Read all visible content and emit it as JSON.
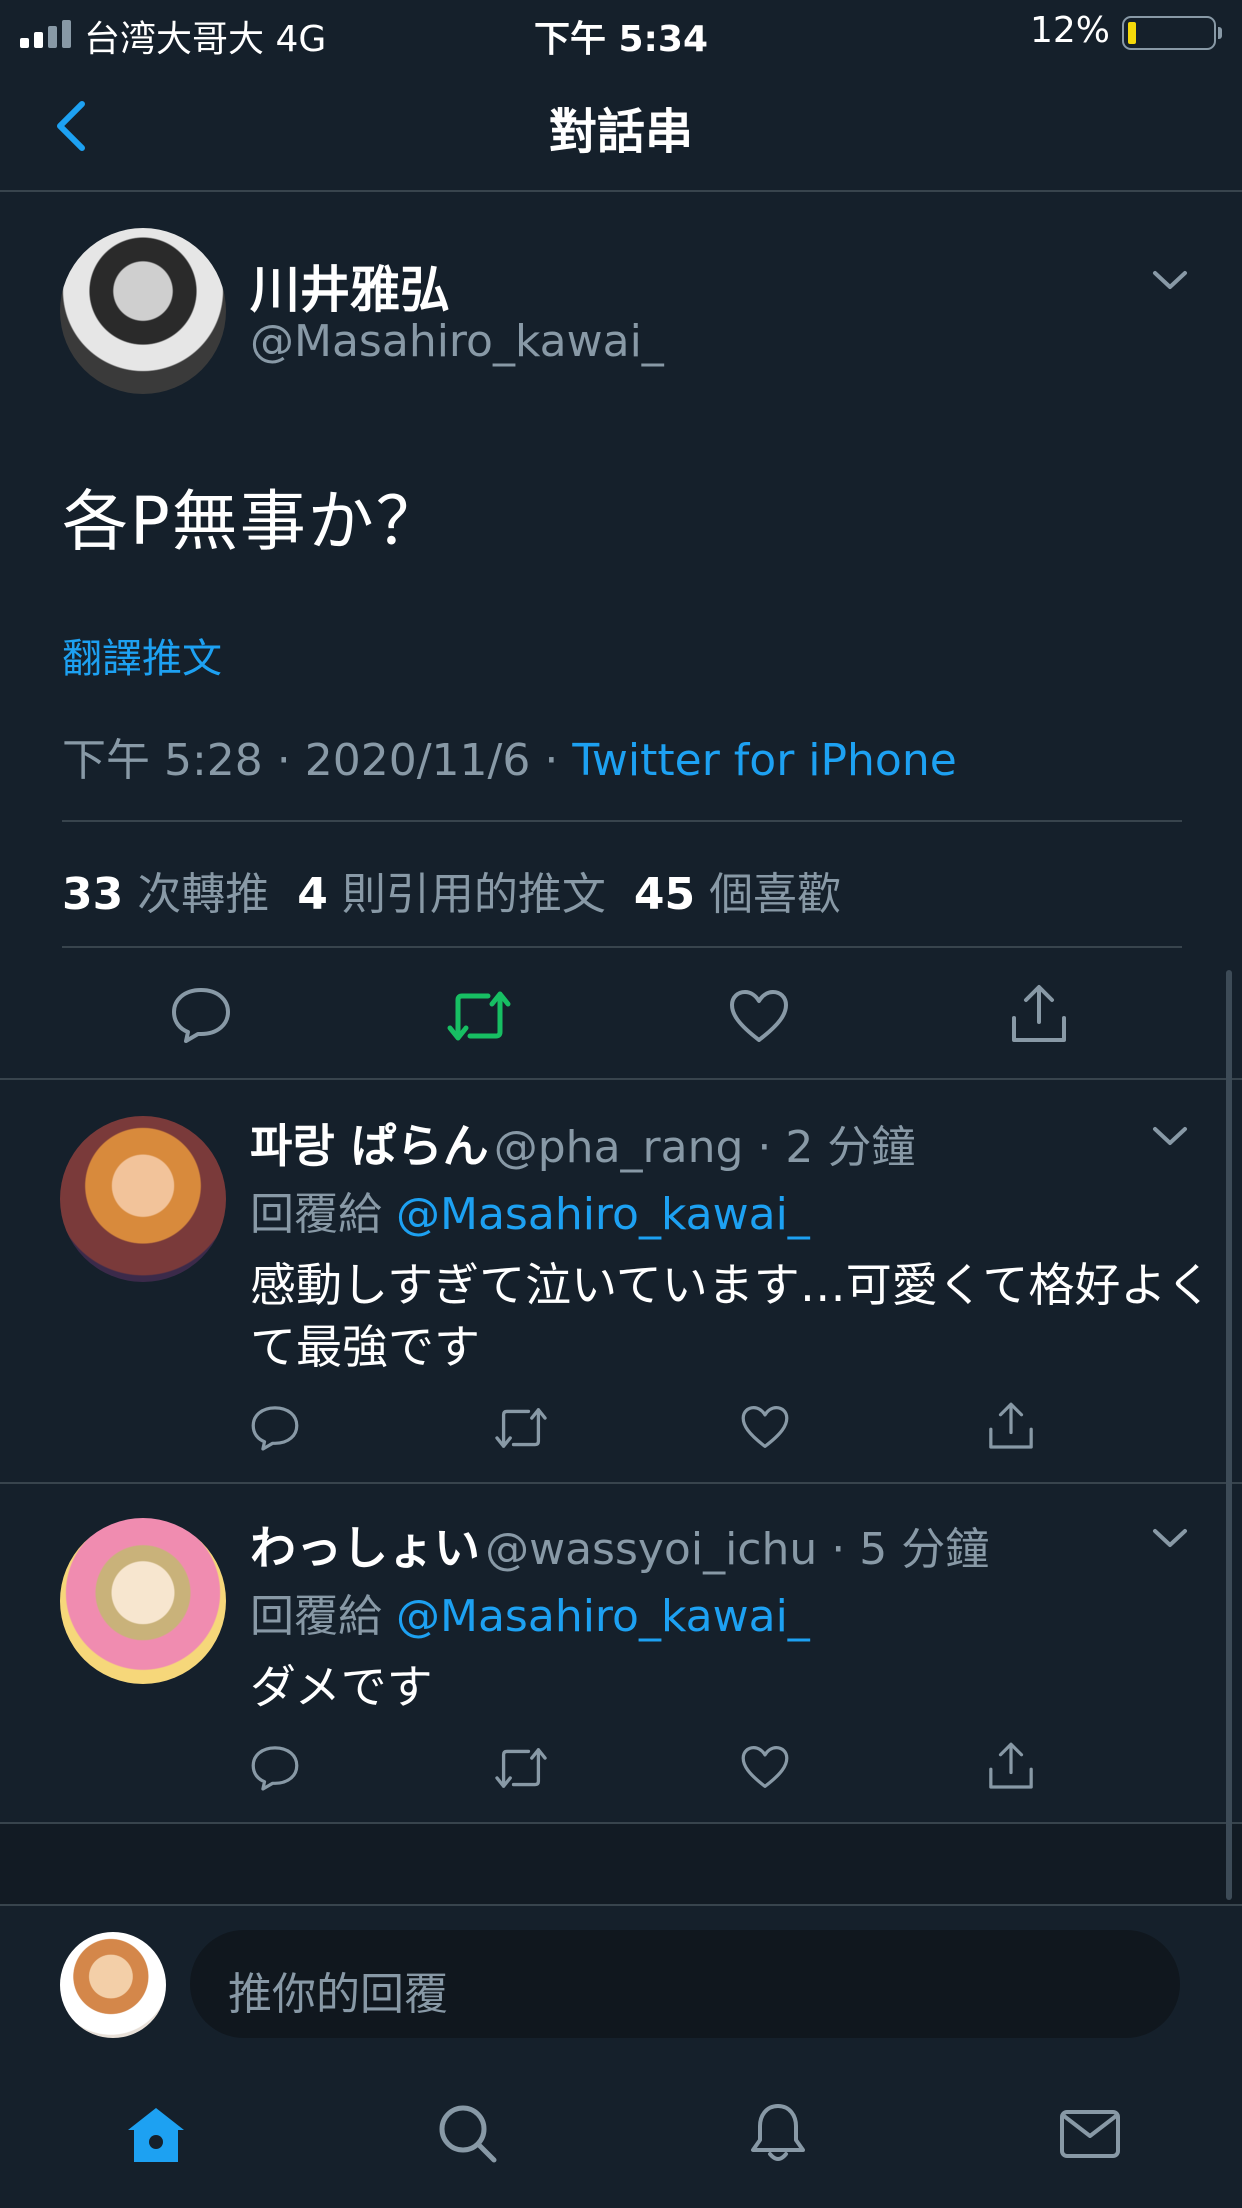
{
  "status_bar": {
    "carrier": "台湾大哥大  4G",
    "time": "下午 5:34",
    "battery_pct": "12%"
  },
  "nav": {
    "title": "對話串"
  },
  "main_tweet": {
    "author_name": "川井雅弘",
    "author_handle": "@Masahiro_kawai_",
    "text": "各P無事か？",
    "translate_label": "翻譯推文",
    "timestamp": "下午 5:28 · 2020/11/6 · ",
    "source": "Twitter for iPhone",
    "stats": {
      "retweets_count": "33",
      "retweets_label": "次轉推",
      "quotes_count": "4",
      "quotes_label": "則引用的推文",
      "likes_count": "45",
      "likes_label": "個喜歡"
    }
  },
  "replies": [
    {
      "name": "파랑 ぱらん",
      "handle_time": "@pha_rang · 2 分鐘",
      "reply_to_label": "回覆給",
      "reply_to_handle": "@Masahiro_kawai_",
      "text": "感動しすぎて泣いています…可愛くて格好よくて最強です"
    },
    {
      "name": "わっしょい",
      "handle_time": "@wassyoi_ichu · 5 分鐘",
      "reply_to_label": "回覆給",
      "reply_to_handle": "@Masahiro_kawai_",
      "text": "ダメです"
    }
  ],
  "composer": {
    "placeholder": "推你的回覆"
  },
  "tab_bar": [
    "home-icon",
    "search-icon",
    "notifications-icon",
    "messages-icon"
  ],
  "colors": {
    "background": "#15202b",
    "accent": "#1da1f2",
    "retweet_active": "#17bf63",
    "muted": "#8899a6",
    "divider": "#38444d"
  }
}
